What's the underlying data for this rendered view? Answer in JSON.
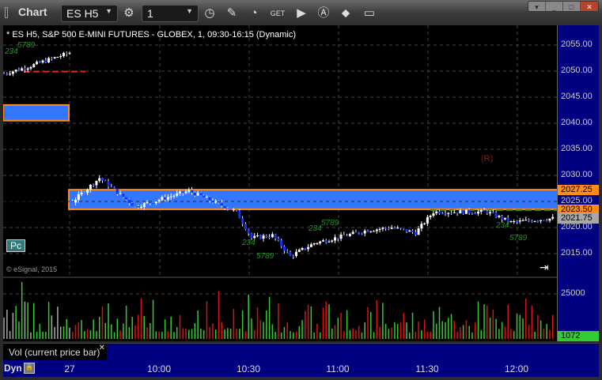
{
  "window": {
    "title": "Chart",
    "symbol": "ES H5",
    "interval": "1"
  },
  "toolbar_icons": [
    "settings-icon",
    "clock-icon",
    "pencil-icon",
    "study-icon",
    "get-icon",
    "play-icon",
    "alert-icon",
    "link-icon",
    "comment-icon"
  ],
  "chart": {
    "header": "* ES H5, S&P 500 E-MINI FUTURES - GLOBEX, 1, 09:30-16:15 (Dynamic)",
    "pc_label": "Pc",
    "copyright": "© eSignal, 2015",
    "r_marker": "(R)",
    "markers": [
      "234",
      "5789",
      "234",
      "5789",
      "234",
      "5789",
      "234",
      "5789"
    ],
    "price_ticks": [
      "2055.00",
      "2050.00",
      "2045.00",
      "2040.00",
      "2035.00",
      "2030.00",
      "2025.00",
      "2020.00",
      "2015.00"
    ],
    "price_labels": [
      {
        "text": "2027.25",
        "value": 2027.25,
        "color": "#ff8c1a"
      },
      {
        "text": "2023.50",
        "value": 2023.5,
        "color": "#ff8c1a"
      },
      {
        "text": "2021.75",
        "value": 2021.75,
        "color": "#a8a8a8"
      }
    ],
    "zone_high": 2027.25,
    "zone_low": 2023.5,
    "prior_zone": [
      2043.5,
      2040.5
    ],
    "red_level": 2049.9,
    "price_path": [
      [
        -22,
        2049.5
      ],
      [
        -14,
        2050.8
      ],
      [
        -8,
        2052
      ],
      [
        0,
        2053.5
      ],
      [
        1,
        2025
      ],
      [
        10,
        2029.5
      ],
      [
        22,
        2024
      ],
      [
        40,
        2027
      ],
      [
        56,
        2023
      ],
      [
        61,
        2018
      ],
      [
        68,
        2018.5
      ],
      [
        74,
        2014.5
      ],
      [
        82,
        2017
      ],
      [
        100,
        2019.5
      ],
      [
        108,
        2020
      ],
      [
        116,
        2019
      ],
      [
        122,
        2023
      ],
      [
        140,
        2023
      ],
      [
        148,
        2021
      ],
      [
        162,
        2021.75
      ]
    ]
  },
  "volume": {
    "axis_label": "25000",
    "current": "1072",
    "pane_label": "Vol (current price bar)"
  },
  "time_axis": {
    "left_label": "Dyn",
    "ticks": [
      "27",
      "10:00",
      "10:30",
      "11:00",
      "11:30",
      "12:00"
    ]
  },
  "colors": {
    "up": "#33cc33",
    "down": "#dd1111",
    "zone": "#3377ff",
    "zone_border": "#ff8c1a"
  }
}
